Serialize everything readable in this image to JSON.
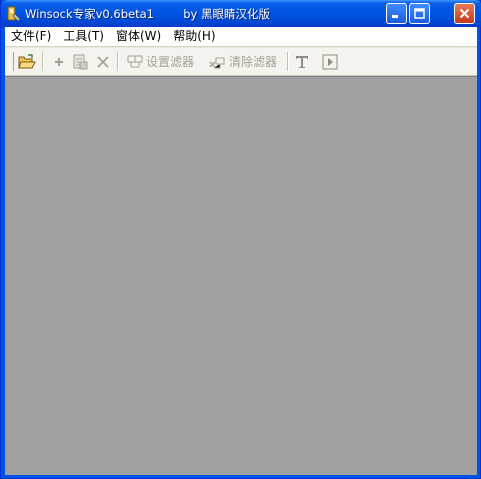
{
  "window": {
    "title": "Winsock专家v0.6beta1        by 黑眼睛汉化版"
  },
  "menu": {
    "items": [
      {
        "label": "文件(F)"
      },
      {
        "label": "工具(T)"
      },
      {
        "label": "窗体(W)"
      },
      {
        "label": "帮助(H)"
      }
    ]
  },
  "toolbar": {
    "open_icon": "folder-open-icon",
    "add_icon": "plus-icon",
    "edit_icon": "document-edit-icon",
    "delete_icon": "x-icon",
    "set_filter_label": "设置滤器",
    "clear_filter_label": "清除滤器",
    "text_icon": "text-T-icon",
    "play_icon": "play-icon"
  },
  "colors": {
    "titlebar": "#0055e5",
    "workspace": "#a0a0a0",
    "disabled_text": "#a3a196"
  }
}
